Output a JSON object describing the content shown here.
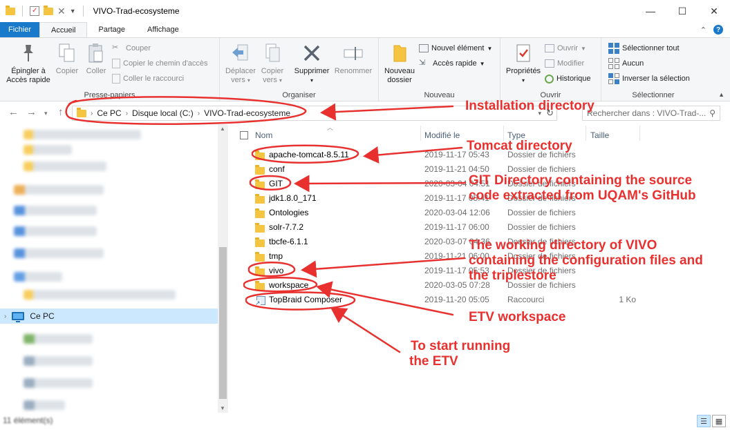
{
  "window": {
    "title": "VIVO-Trad-ecosysteme",
    "minimize": "—",
    "maximize": "☐",
    "close": "✕"
  },
  "ribbon_tabs": [
    "Fichier",
    "Accueil",
    "Partage",
    "Affichage"
  ],
  "ribbon": {
    "pin_label_1": "Épingler à",
    "pin_label_2": "Accès rapide",
    "copy": "Copier",
    "paste": "Coller",
    "cut": "Couper",
    "copy_path": "Copier le chemin d'accès",
    "paste_shortcut": "Coller le raccourci",
    "group_clipboard": "Presse-papiers",
    "move_to_1": "Déplacer",
    "move_to_2": "vers",
    "copy_to_1": "Copier",
    "copy_to_2": "vers",
    "delete": "Supprimer",
    "rename": "Renommer",
    "group_organize": "Organiser",
    "new_folder_1": "Nouveau",
    "new_folder_2": "dossier",
    "new_item": "Nouvel élément",
    "easy_access": "Accès rapide",
    "group_new": "Nouveau",
    "properties": "Propriétés",
    "open": "Ouvrir",
    "edit": "Modifier",
    "history": "Historique",
    "group_open": "Ouvrir",
    "select_all": "Sélectionner tout",
    "select_none": "Aucun",
    "invert_selection": "Inverser la sélection",
    "group_select": "Sélectionner"
  },
  "address": {
    "crumbs": [
      "Ce PC",
      "Disque local (C:)",
      "VIVO-Trad-ecosysteme"
    ],
    "search_placeholder": "Rechercher dans : VIVO-Trad-..."
  },
  "navigation": {
    "selected": "Ce PC"
  },
  "columns": [
    "Nom",
    "Modifié le",
    "Type",
    "Taille"
  ],
  "files": [
    {
      "name": "apache-tomcat-8.5.11",
      "date": "2019-11-17 05:43",
      "type": "Dossier de fichiers",
      "size": "",
      "icon": "folder-icon"
    },
    {
      "name": "conf",
      "date": "2019-11-21 04:50",
      "type": "Dossier de fichiers",
      "size": "",
      "icon": "folder-icon"
    },
    {
      "name": "GIT",
      "date": "2020-03-04 04:51",
      "type": "Dossier de fichiers",
      "size": "",
      "icon": "folder-icon"
    },
    {
      "name": "jdk1.8.0_171",
      "date": "2019-11-17 05:41",
      "type": "Dossier de fichiers",
      "size": "",
      "icon": "folder-icon"
    },
    {
      "name": "Ontologies",
      "date": "2020-03-04 12:06",
      "type": "Dossier de fichiers",
      "size": "",
      "icon": "folder-icon"
    },
    {
      "name": "solr-7.7.2",
      "date": "2019-11-17 06:00",
      "type": "Dossier de fichiers",
      "size": "",
      "icon": "folder-icon"
    },
    {
      "name": "tbcfe-6.1.1",
      "date": "2020-03-07 04:36",
      "type": "Dossier de fichiers",
      "size": "",
      "icon": "folder-icon"
    },
    {
      "name": "tmp",
      "date": "2019-11-21 06:00",
      "type": "Dossier de fichiers",
      "size": "",
      "icon": "folder-icon"
    },
    {
      "name": "vivo",
      "date": "2019-11-17 05:53",
      "type": "Dossier de fichiers",
      "size": "",
      "icon": "folder-icon"
    },
    {
      "name": "workspace",
      "date": "2020-03-05 07:28",
      "type": "Dossier de fichiers",
      "size": "",
      "icon": "folder-icon"
    },
    {
      "name": "TopBraid Composer",
      "date": "2019-11-20 05:05",
      "type": "Raccourci",
      "size": "1 Ko",
      "icon": "shortcut-icon"
    }
  ],
  "annotations": {
    "install": "Installation directory",
    "tomcat": "Tomcat directory",
    "git_1": "GIT Directory containing the source",
    "git_2": "code extracted from UQAM's GitHub",
    "vivo_1": "The working directory of VIVO",
    "vivo_2": "containing the configuration files and",
    "vivo_3": "the triplestore",
    "etv_ws": "ETV workspace",
    "etv_1": "To start running",
    "etv_2": "the ETV"
  },
  "colors": {
    "annotation": "#e8312f",
    "file_tab": "#1979ca",
    "selection": "#cce8ff",
    "folder": "#f5c542"
  },
  "status": {
    "items": "11 élément(s)"
  }
}
